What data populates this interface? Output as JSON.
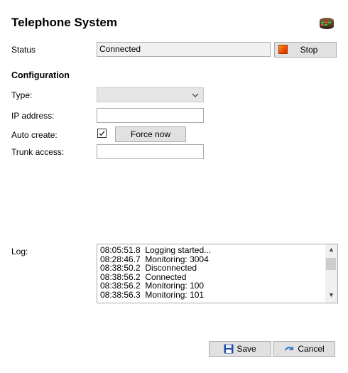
{
  "header": {
    "title": "Telephone System",
    "app_icon": "phone-system-icon"
  },
  "status": {
    "label": "Status",
    "value": "Connected",
    "stop_label": "Stop"
  },
  "configuration": {
    "heading": "Configuration",
    "type_label": "Type:",
    "type_value": "",
    "ip_label": "IP address:",
    "ip_value": "",
    "auto_create_label": "Auto create:",
    "auto_create_checked": true,
    "force_now_label": "Force now",
    "trunk_label": "Trunk access:",
    "trunk_value": ""
  },
  "log": {
    "label": "Log:",
    "lines": [
      "08:05:51.8  Logging started...",
      "08:28:46.7  Monitoring: 3004",
      "08:38:50.2  Disconnected",
      "08:38:56.2  Connected",
      "08:38:56.2  Monitoring: 100",
      "08:38:56.3  Monitoring: 101"
    ]
  },
  "footer": {
    "save_label": "Save",
    "cancel_label": "Cancel"
  },
  "colors": {
    "stop_accent": "#f05a00",
    "save_icon": "#1f4fa8",
    "cancel_icon": "#3a7bd5"
  }
}
